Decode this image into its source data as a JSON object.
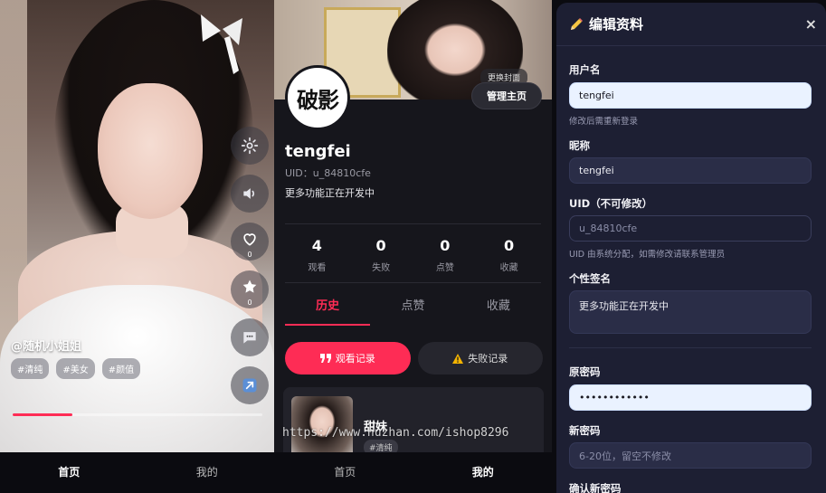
{
  "feed": {
    "author": "@随机小姐姐",
    "tags": [
      "#清纯",
      "#美女",
      "#颜值"
    ],
    "like_count": "0",
    "favorite_count": "0",
    "progress": 0.24,
    "icons": [
      "gear-icon",
      "volume-icon",
      "heart-icon",
      "star-icon",
      "comment-icon",
      "share-icon"
    ]
  },
  "bottom_nav": {
    "left": {
      "home": "首页",
      "me": "我的"
    },
    "right": {
      "home": "首页",
      "me": "我的"
    }
  },
  "profile": {
    "cover_button": "更换封面",
    "manage_button": "管理主页",
    "avatar_text": "破影",
    "username": "tengfei",
    "uid_label": "UID：u_84810cfe",
    "bio": "更多功能正在开发中",
    "stats": [
      {
        "value": "4",
        "label": "观看"
      },
      {
        "value": "0",
        "label": "失败"
      },
      {
        "value": "0",
        "label": "点赞"
      },
      {
        "value": "0",
        "label": "收藏"
      }
    ],
    "tabs": [
      "历史",
      "点赞",
      "收藏"
    ],
    "watch_record_button": "观看记录",
    "fail_record_button": "失败记录",
    "card": {
      "title": "甜妹",
      "tag": "#清纯"
    }
  },
  "edit_modal": {
    "title": "编辑资料",
    "close": "×",
    "username_label": "用户名",
    "username_value": "tengfei",
    "username_hint": "修改后需重新登录",
    "nickname_label": "昵称",
    "nickname_value": "tengfei",
    "uid_label": "UID（不可修改）",
    "uid_value": "u_84810cfe",
    "uid_hint": "UID 由系统分配，如需修改请联系管理员",
    "signature_label": "个性签名",
    "signature_value": "更多功能正在开发中",
    "old_password_label": "原密码",
    "old_password_value": "••••••••••••",
    "new_password_label": "新密码",
    "new_password_placeholder": "6-20位，留空不修改",
    "confirm_password_label": "确认新密码"
  },
  "watermark": "https://www.huzhan.com/ishop8296",
  "colors": {
    "accent": "#fe2c55",
    "modal_bg": "#1d1f33",
    "warning": "#f5b400"
  }
}
